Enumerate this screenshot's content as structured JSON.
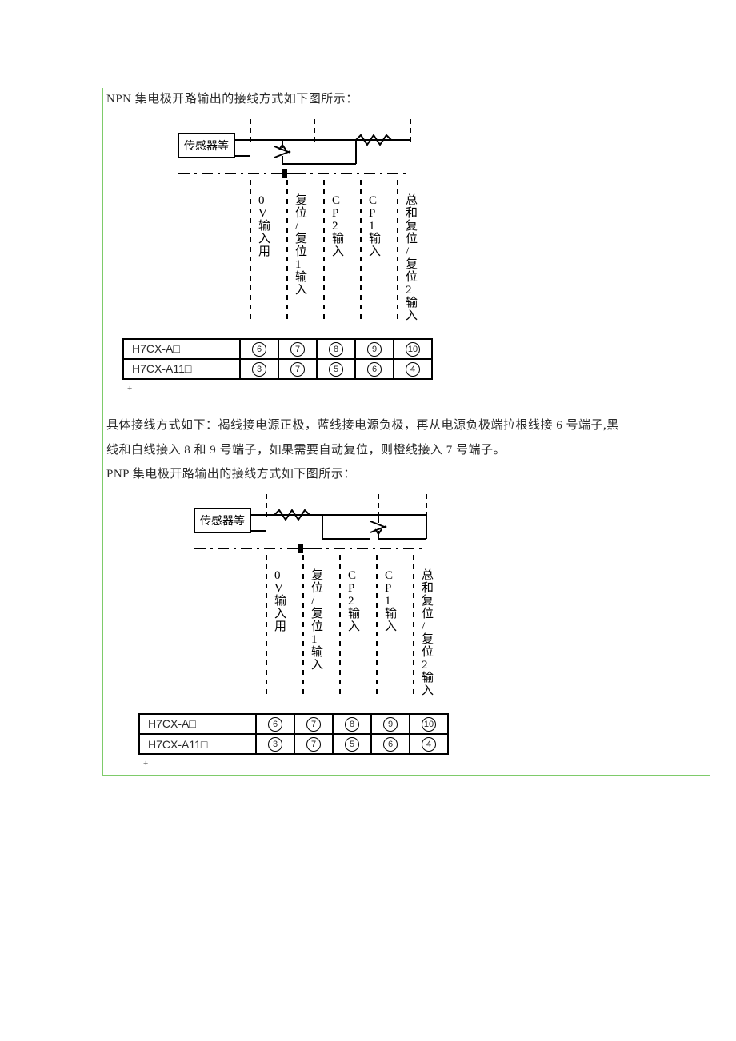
{
  "intro_npn": "NPN 集电极开路输出的接线方式如下图所示：",
  "mid_para1": "具体接线方式如下：褐线接电源正极，蓝线接电源负极，再从电源负极端拉根线接 6 号端子,黑",
  "mid_para2": "线和白线接入 8 和 9 号端子，如果需要自动复位，则橙线接入 7 号端子。",
  "intro_pnp": "PNP 集电极开路输出的接线方式如下图所示：",
  "sensor_label": "传感器等",
  "col_labels": {
    "c0": "0V输入用",
    "c1": "复位/复位1输入",
    "c2": "CP2输入",
    "c3": "CP1输入",
    "c4": "总和复位/复位2输入"
  },
  "rows": {
    "a": "H7CX-A□",
    "a11": "H7CX-A11□"
  },
  "nums_a": [
    "6",
    "7",
    "8",
    "9",
    "10"
  ],
  "nums_a11": [
    "3",
    "7",
    "5",
    "6",
    "4"
  ],
  "plus": "+"
}
